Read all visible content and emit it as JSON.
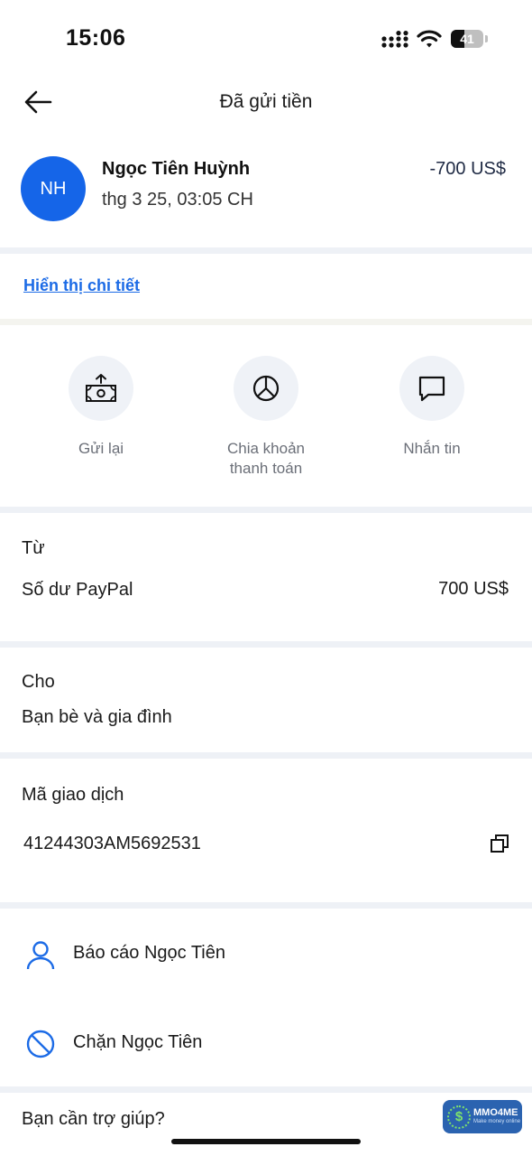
{
  "status_bar": {
    "time": "15:06",
    "battery": "41",
    "battery_level": 0.41
  },
  "header": {
    "title": "Đã gửi tiền",
    "back_icon": "arrow-left-icon"
  },
  "transaction": {
    "avatar_initials": "NH",
    "name": "Ngọc Tiên Huỳnh",
    "date": "thg 3 25, 03:05 CH",
    "amount": "-700 US$",
    "details_link": "Hiển thị chi tiết"
  },
  "actions": [
    {
      "label": "Gửi lại",
      "icon": "send-money-icon"
    },
    {
      "label": "Chia khoản\nthanh toán",
      "icon": "pie-chart-icon"
    },
    {
      "label": "Nhắn tin",
      "icon": "message-icon"
    }
  ],
  "from": {
    "label": "Từ",
    "source": "Số dư PayPal",
    "amount": "700 US$"
  },
  "to": {
    "label": "Cho",
    "value": "Bạn bè và gia đình"
  },
  "transaction_id": {
    "label": "Mã giao dịch",
    "value": "41244303AM5692531",
    "copy_icon": "copy-icon"
  },
  "report": {
    "label": "Báo cáo Ngọc Tiên",
    "icon": "person-icon"
  },
  "block": {
    "label": "Chặn Ngọc Tiên",
    "icon": "block-icon"
  },
  "help": {
    "label": "Bạn cần trợ giúp?"
  },
  "watermark": {
    "title": "MMO4ME",
    "subtitle": "Make money online",
    "coin": "$"
  },
  "colors": {
    "brand_blue": "#1565e8",
    "link_blue": "#1c6be6",
    "divider": "#eef1f6",
    "muted": "#6b6f78"
  }
}
